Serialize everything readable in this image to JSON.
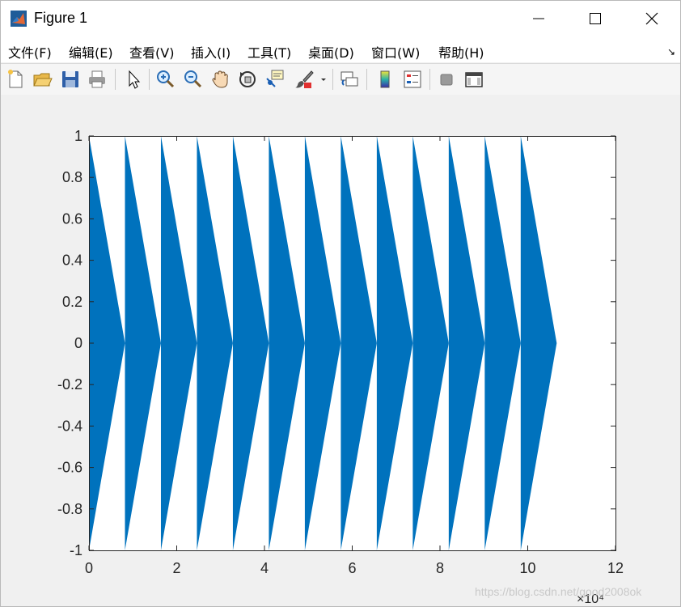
{
  "window": {
    "title": "Figure 1"
  },
  "menu": [
    "文件(F)",
    "编辑(E)",
    "查看(V)",
    "插入(I)",
    "工具(T)",
    "桌面(D)",
    "窗口(W)",
    "帮助(H)"
  ],
  "menu_undock": "↘",
  "toolbar": [
    {
      "name": "new-figure-icon"
    },
    {
      "name": "open-file-icon"
    },
    {
      "name": "save-icon"
    },
    {
      "name": "print-icon"
    },
    {
      "name": "edit-plot-arrow-icon"
    },
    {
      "name": "zoom-in-icon"
    },
    {
      "name": "zoom-out-icon"
    },
    {
      "name": "pan-hand-icon"
    },
    {
      "name": "rotate-3d-icon"
    },
    {
      "name": "data-cursor-icon"
    },
    {
      "name": "brush-icon"
    },
    {
      "name": "brush-dropdown-icon"
    },
    {
      "name": "link-plot-icon"
    },
    {
      "name": "insert-colorbar-icon"
    },
    {
      "name": "insert-legend-icon"
    },
    {
      "name": "hide-plot-tools-icon"
    },
    {
      "name": "show-plot-tools-icon"
    }
  ],
  "watermark": "https://blog.csdn.net/good2008ok",
  "chart_data": {
    "type": "area",
    "title": "",
    "xlabel": "",
    "ylabel": "",
    "xlim": [
      0,
      120000
    ],
    "ylim": [
      -1,
      1
    ],
    "x_ticks": [
      0,
      20000,
      40000,
      60000,
      80000,
      100000,
      120000
    ],
    "x_tick_labels": [
      "0",
      "2",
      "4",
      "6",
      "8",
      "10",
      "12"
    ],
    "x_exponent_label": "×10⁴",
    "y_ticks": [
      1,
      0.8,
      0.6,
      0.4,
      0.2,
      0,
      -0.2,
      -0.4,
      -0.6,
      -0.8,
      -1
    ],
    "y_tick_labels": [
      "1",
      "0.8",
      "0.6",
      "0.4",
      "0.2",
      "0",
      "-0.2",
      "-0.4",
      "-0.6",
      "-0.8",
      "-1"
    ],
    "series": [
      {
        "color": "#0072bd",
        "description_points": {
          "segment_starts_x": [
            0,
            8200,
            16400,
            24600,
            32800,
            41000,
            49200,
            57400,
            65600,
            73800,
            82000,
            90200,
            98400
          ],
          "segment_length_x": 8200,
          "envelope_start": 1,
          "envelope_end": 0
        }
      }
    ],
    "grid": false,
    "background": "#ffffff"
  }
}
